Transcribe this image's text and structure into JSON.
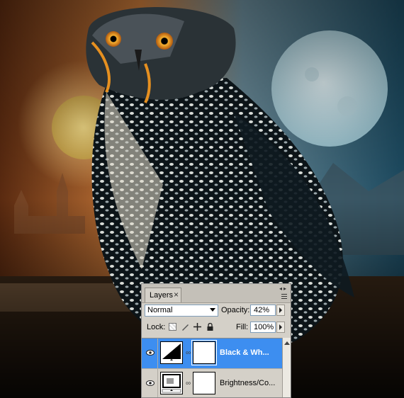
{
  "panel": {
    "tab_label": "Layers",
    "tab_close": "×",
    "blend_mode": "Normal",
    "opacity_label": "Opacity:",
    "opacity_value": "42%",
    "lock_label": "Lock:",
    "fill_label": "Fill:",
    "fill_value": "100%",
    "layers": [
      {
        "name": "Black & Wh...",
        "selected": true,
        "thumb_icon": "black-white-adjustment-icon"
      },
      {
        "name": "Brightness/Co...",
        "selected": false,
        "thumb_icon": "brightness-contrast-adjustment-icon"
      }
    ]
  },
  "colors": {
    "selection": "#3d8ef0",
    "panel_bg": "#d4d0c8"
  }
}
